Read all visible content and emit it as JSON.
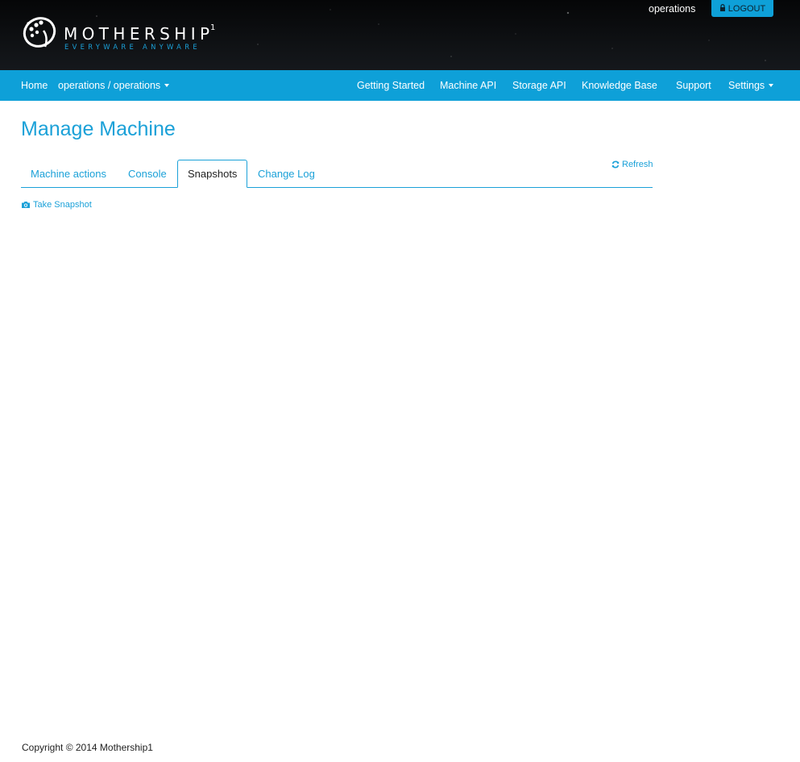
{
  "header": {
    "brand_name": "MOTHERSHIP",
    "brand_sup": "1",
    "brand_tagline": "EVERYWARE ANYWARE",
    "user": "operations",
    "logout_label": "LOGOUT"
  },
  "nav": {
    "home": "Home",
    "org_selector": "operations / operations",
    "getting_started": "Getting Started",
    "machine_api": "Machine API",
    "storage_api": "Storage API",
    "knowledge_base": "Knowledge Base",
    "support": "Support",
    "settings": "Settings"
  },
  "main": {
    "title": "Manage Machine",
    "refresh_label": "Refresh",
    "tabs": [
      {
        "label": "Machine actions"
      },
      {
        "label": "Console"
      },
      {
        "label": "Snapshots"
      },
      {
        "label": "Change Log"
      }
    ],
    "active_tab": "Snapshots",
    "take_snapshot_label": "Take Snapshot"
  },
  "footer": {
    "copyright": "Copyright © 2014 Mothership1"
  },
  "colors": {
    "accent": "#0ea0d8",
    "link": "#1ba1d8",
    "header_bg": "#0a0b0d"
  },
  "icons": {
    "logo": "mothership-logo-icon",
    "lock": "lock-icon",
    "refresh": "refresh-icon",
    "camera": "camera-icon",
    "caret": "caret-down-icon"
  }
}
